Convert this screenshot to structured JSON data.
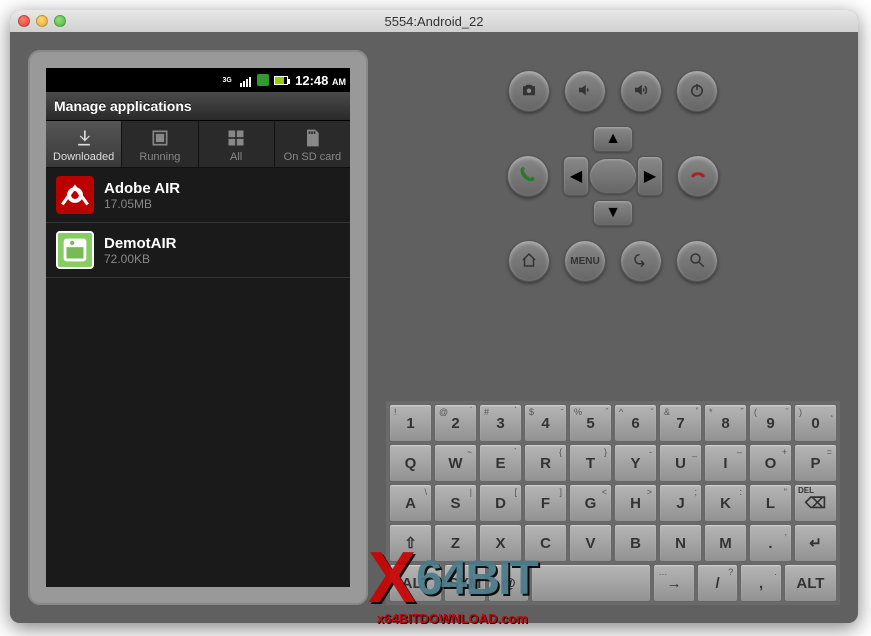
{
  "window": {
    "title": "5554:Android_22"
  },
  "status": {
    "time": "12:48",
    "ampm": "AM"
  },
  "screen": {
    "title": "Manage applications"
  },
  "tabs": [
    {
      "label": "Downloaded",
      "icon": "download-icon",
      "active": true
    },
    {
      "label": "Running",
      "icon": "running-icon",
      "active": false
    },
    {
      "label": "All",
      "icon": "grid-icon",
      "active": false
    },
    {
      "label": "On SD card",
      "icon": "sdcard-icon",
      "active": false
    }
  ],
  "apps": [
    {
      "name": "Adobe AIR",
      "size": "17.05MB",
      "icon_class": "air"
    },
    {
      "name": "DemotAIR",
      "size": "72.00KB",
      "icon_class": "green"
    }
  ],
  "hw_buttons": {
    "row1": [
      "camera-icon",
      "volume-down-icon",
      "volume-up-icon",
      "power-icon"
    ],
    "row2_left": "call-icon",
    "row2_right": "endcall-icon",
    "row3": [
      "home-icon",
      "menu-icon",
      "back-icon",
      "search-icon"
    ]
  },
  "menu_label": "MENU",
  "keyboard": {
    "row1": [
      {
        "m": "1",
        "a1": "!"
      },
      {
        "m": "2",
        "a1": "@",
        "a2": "́"
      },
      {
        "m": "3",
        "a1": "#",
        "a2": "̀"
      },
      {
        "m": "4",
        "a1": "$",
        "a2": "̄"
      },
      {
        "m": "5",
        "a1": "%",
        "a2": "̂"
      },
      {
        "m": "6",
        "a1": "^",
        "a2": "̆"
      },
      {
        "m": "7",
        "a1": "&",
        "a2": "̊"
      },
      {
        "m": "8",
        "a1": "*",
        "a2": "̋"
      },
      {
        "m": "9",
        "a1": "(",
        "a2": "̌"
      },
      {
        "m": "0",
        "a1": ")",
        "a2": "̨"
      }
    ],
    "row2": [
      {
        "m": "Q"
      },
      {
        "m": "W",
        "a2": "~"
      },
      {
        "m": "E",
        "a2": "`"
      },
      {
        "m": "R",
        "a2": "{"
      },
      {
        "m": "T",
        "a2": "}"
      },
      {
        "m": "Y",
        "a2": "-"
      },
      {
        "m": "U",
        "a2": "_"
      },
      {
        "m": "I",
        "a2": "–"
      },
      {
        "m": "O",
        "a2": "+"
      },
      {
        "m": "P",
        "a2": "="
      }
    ],
    "row3": [
      {
        "m": "A",
        "a2": "\\"
      },
      {
        "m": "S",
        "a2": "|"
      },
      {
        "m": "D",
        "a2": "["
      },
      {
        "m": "F",
        "a2": "]"
      },
      {
        "m": "G",
        "a2": "<"
      },
      {
        "m": "H",
        "a2": ">"
      },
      {
        "m": "J",
        "a2": ";"
      },
      {
        "m": "K",
        "a2": ":"
      },
      {
        "m": "L",
        "a2": "\""
      },
      {
        "m": "DEL",
        "special": true,
        "icon": "⌫"
      }
    ],
    "row4": [
      {
        "m": "⇧",
        "special": true
      },
      {
        "m": "Z"
      },
      {
        "m": "X"
      },
      {
        "m": "C"
      },
      {
        "m": "V"
      },
      {
        "m": "B"
      },
      {
        "m": "N"
      },
      {
        "m": "M"
      },
      {
        "m": ".",
        "a2": ","
      },
      {
        "m": "↵",
        "special": true
      }
    ],
    "row5": [
      {
        "m": "ALT",
        "special": true,
        "wide": true
      },
      {
        "m": "SYM",
        "special": true
      },
      {
        "m": "@",
        "a2": "'"
      },
      {
        "m": " ",
        "space": true
      },
      {
        "m": "→",
        "a1": "…"
      },
      {
        "m": "/",
        "a2": "?"
      },
      {
        "m": ",",
        "a2": "."
      },
      {
        "m": "ALT",
        "special": true,
        "wide": true
      }
    ]
  },
  "watermark": {
    "big": "64BIT",
    "sub": "x64BITDOWNLOAD.com"
  }
}
